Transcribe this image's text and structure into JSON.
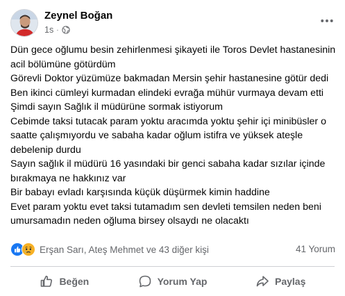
{
  "post": {
    "author": "Zeynel Boğan",
    "time": "1s",
    "separator": "·",
    "privacy_icon": "globe-icon",
    "lines": [
      "Dün gece oğlumu besin zehirlenmesi şikayeti ile Toros Devlet hastanesinin acil bölümüne götürdüm",
      "Görevli Doktor yüzümüze bakmadan Mersin şehir hastanesine götür dedi Ben ikinci cümleyi kurmadan elindeki evrağa mühür vurmaya devam etti",
      "Şimdi sayın Sağlık il müdürüne sormak istiyorum",
      "Cebimde taksi tutacak param yoktu aracımda yoktu şehir içi minibüsler o saatte çalışmıyordu ve sabaha kadar oğlum istifra ve yüksek ateşle debelenip durdu",
      "Sayın sağlık il müdürü 16 yasındaki bir genci sabaha kadar sızılar içinde bırakmaya  ne hakkınız var",
      "Bir babayı evladı karşısında küçük düşürmek kimin haddine",
      "Evet param yoktu evet taksi tutamadım sen devleti temsilen neden beni umursamadın neden oğluma birsey olsaydı ne olacaktı"
    ]
  },
  "reactions": {
    "icons": [
      "like-reaction-icon",
      "sad-reaction-icon"
    ],
    "summary": "Erşan Sarı, Ateş Mehmet ve 43 diğer kişi",
    "comments": "41 Yorum"
  },
  "actions": {
    "like": "Beğen",
    "comment": "Yorum Yap",
    "share": "Paylaş"
  },
  "colors": {
    "text": "#050505",
    "secondary": "#65676b",
    "like_blue": "#1877f2",
    "sad_yellow": "#f7b125",
    "divider": "#ced0d4"
  }
}
